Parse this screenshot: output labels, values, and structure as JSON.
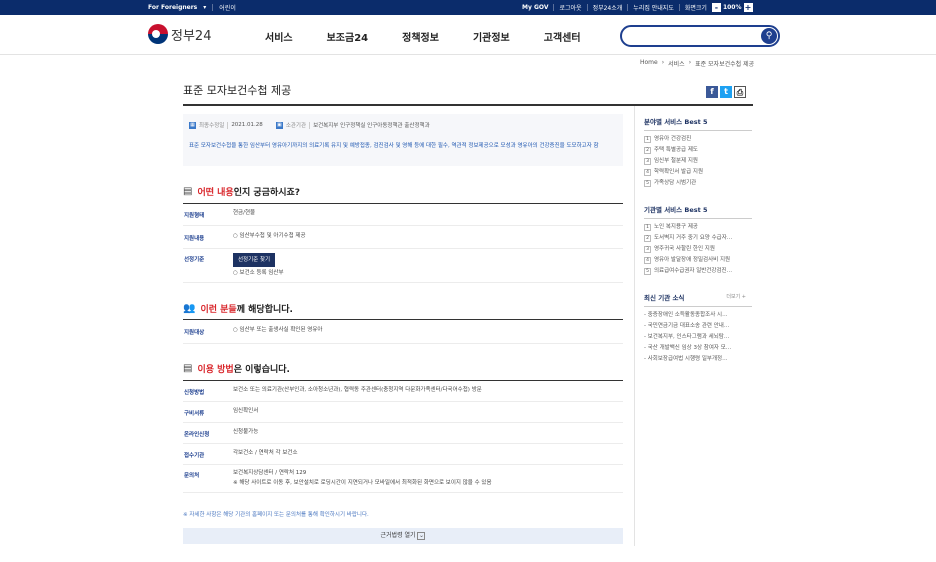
{
  "util": {
    "foreigners": "For Foreigners",
    "kids": "어린이",
    "mygov": "My GOV",
    "logout": "로그아웃",
    "gov24_intro": "정부24소개",
    "sitemap": "누리집 안내지도",
    "zoom_label": "화면크기",
    "zoom_minus": "-",
    "zoom_value": "100%",
    "zoom_plus": "+"
  },
  "header": {
    "logo_text": "정부24",
    "menu": [
      "서비스",
      "보조금24",
      "정책정보",
      "기관정보",
      "고객센터"
    ],
    "search_placeholder": ""
  },
  "breadcrumb": [
    "Home",
    "서비스",
    "표준 모자보건수첩 제공"
  ],
  "page": {
    "title": "표준 모자보건수첩 제공",
    "share": [
      "f",
      "t",
      "p"
    ]
  },
  "info": {
    "date_label": "최종수정일",
    "date": "2021.01.28",
    "dept_label": "소관기관",
    "dept": "보건복지부 인구정책실 인구아동정책관 출산정책과",
    "desc": "표준 모자보건수첩을 통한 임산부터 영유아기까지의 의료기록 유지 및 예방접종, 검진검사 및 영해 등에 대한 필수, 역관적 정보제공으로 모성과 영유아의 건강증진을 도모하고자 함"
  },
  "section1": {
    "highlight": "어떤 내용",
    "rest": "인지 궁금하시죠?",
    "rows": [
      {
        "label": "지원형태",
        "value": "현금/현물"
      },
      {
        "label": "지원내용",
        "value": "○ 임산부수첩 및 아기수첩 제공"
      },
      {
        "label": "선정기준",
        "button": "선정기준 찾기",
        "value": "○ 보건소 등록 임산부"
      }
    ]
  },
  "section2": {
    "highlight": "이런 분들",
    "rest": "께 해당합니다.",
    "rows": [
      {
        "label": "지원대상",
        "value": "○ 임산부 또는 출생사실 확인된 영유아"
      }
    ]
  },
  "section3": {
    "highlight": "이용 방법",
    "rest": "은 이렇습니다.",
    "rows": [
      {
        "label": "신청방법",
        "value": "보건소 또는 의료기관(산부인과, 소아청소년과), 협력동 주관센터(충청지역 다문화가족센터/다국어수첩) 방문"
      },
      {
        "label": "구비서류",
        "value": "임신확인서"
      },
      {
        "label": "온라인신청",
        "value": "신청불가능"
      },
      {
        "label": "접수기관",
        "value": "각보건소 / 연락처 각 보건소"
      },
      {
        "label": "문의처",
        "value": "보건복지상담센터 / 연락처 129",
        "value2": "※ 해당 사이트로 이동 후, 보안설치로 로딩시간이 지연되거나 모바일에서 최적화된 화면으로 보이지 않을 수 있음"
      }
    ]
  },
  "footer_note": "※ 자세한 사항은 해당 기관의 홈페이지 또는 문의처를 통해 확인하시기 바랍니다.",
  "law_bar": "근거법령 열기",
  "sidebar": {
    "best_title": "분야별 서비스 Best 5",
    "best": [
      "영유아 건강검진",
      "주택 특별공급 제도",
      "임신부 철분제 지원",
      "학력확인서 발급 지원",
      "가족상담 시범기관"
    ],
    "org_title": "기관별 서비스 Best 5",
    "org": [
      "노인 복지용구 제공",
      "도서벽지 거주 중기 요양 수급자…",
      "영주귀국 사할린 한인 지원",
      "영유아 발달장애 정밀검사비 지원",
      "의료급여수급권자 일반건강검진…"
    ],
    "news_title": "최신 기관 소식",
    "news_more": "더보기 +",
    "news": [
      "중증장애인 소득활동종합조사 시…",
      "국민연금기금 대표소송 관련 안내…",
      "보건복지부, 인스타그램과 세뇌탐…",
      "국산 개발백신 임상 3상 참여자 모…",
      "사회보장급여법 시행령 일부개정…"
    ]
  },
  "colors": {
    "navy": "#0b2c6b",
    "accent_red": "#d9262b",
    "blue_text": "#1d56b0"
  }
}
